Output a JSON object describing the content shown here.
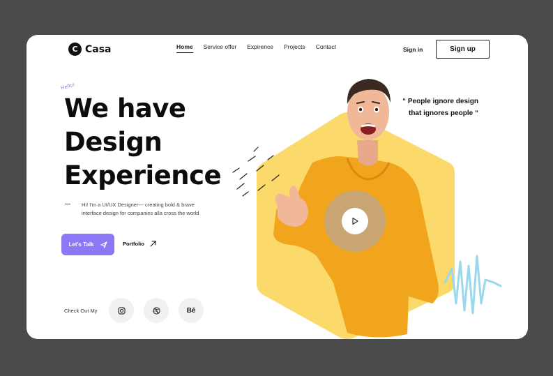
{
  "brand": {
    "logo_letter": "C",
    "name": "Casa"
  },
  "nav": {
    "items": [
      "Home",
      "Service offer",
      "Expirence",
      "Projects",
      "Contact"
    ],
    "active": "Home"
  },
  "auth": {
    "signin_label": "Sign in",
    "signup_label": "Sign up"
  },
  "hero": {
    "greeting": "Hello!",
    "headline": [
      "We have",
      "Design",
      "Experience"
    ],
    "intro_line1": "Hi! I'm a UI/UX Designer---  creating bold & brave",
    "intro_line2": "interface design for companies alla cross the world",
    "cta_primary": "Let's Talk",
    "cta_secondary": "Portfolio",
    "quote_line1": "“ People ignore design",
    "quote_line2": "that ignores people “"
  },
  "social": {
    "label": "Check Out My",
    "items": [
      {
        "icon": "instagram-icon"
      },
      {
        "icon": "dribbble-icon"
      },
      {
        "icon": "behance-icon",
        "text": "Bē"
      }
    ]
  },
  "colors": {
    "accent": "#8b78f4",
    "hexagon": "#fbd96a",
    "sweater": "#f1a51d",
    "squiggle": "#9ad8ec",
    "background": "#4a4a4a"
  }
}
